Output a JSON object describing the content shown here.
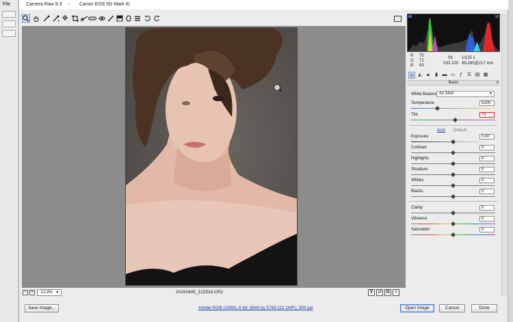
{
  "host": {
    "menu_file": "File"
  },
  "window": {
    "title": "Camera Raw 9.3",
    "camera": "Canon EOS 5D Mark III"
  },
  "toolbar": {
    "tools": [
      {
        "name": "zoom-tool-icon",
        "glyph": "🔍︎",
        "selected": true
      },
      {
        "name": "hand-tool-icon",
        "glyph": "✋︎"
      },
      {
        "name": "white-balance-tool-icon",
        "glyph": "⁄"
      },
      {
        "name": "color-sampler-tool-icon",
        "glyph": "⁄"
      },
      {
        "name": "targeted-adjustment-tool-icon",
        "glyph": "⊹"
      },
      {
        "name": "crop-tool-icon",
        "glyph": "⌗"
      },
      {
        "name": "straighten-tool-icon",
        "glyph": "≗"
      },
      {
        "name": "spot-removal-tool-icon",
        "glyph": "⚲"
      },
      {
        "name": "red-eye-tool-icon",
        "glyph": "◉"
      },
      {
        "name": "adjustment-brush-icon",
        "glyph": "⁄"
      },
      {
        "name": "graduated-filter-icon",
        "glyph": "▆"
      },
      {
        "name": "radial-filter-icon",
        "glyph": "◯"
      },
      {
        "name": "preferences-icon",
        "glyph": "≡"
      },
      {
        "name": "rotate-ccw-icon",
        "glyph": "↺"
      },
      {
        "name": "rotate-cw-icon",
        "glyph": "↻"
      }
    ]
  },
  "canvas": {
    "zoom": "12.9%",
    "filename": "20150405_122533.CR2"
  },
  "readout": {
    "r_label": "R:",
    "r_value": "75",
    "g_label": "G:",
    "g_value": "71",
    "b_label": "B:",
    "b_value": "63",
    "aperture": "f/8",
    "shutter": "1/125 s",
    "iso": "ISO 100",
    "lens": "98-280@217 mm"
  },
  "panel": {
    "section_title": "Basic",
    "white_balance_label": "White Balance:",
    "white_balance_value": "As Shot",
    "temperature_label": "Temperature",
    "temperature_value": "5200",
    "tint_label": "Tint",
    "tint_value": "+5",
    "auto_label": "Auto",
    "default_label": "Default",
    "exposure_label": "Exposure",
    "exposure_value": "0.00",
    "contrast_label": "Contrast",
    "contrast_value": "0",
    "highlights_label": "Highlights",
    "highlights_value": "0",
    "shadows_label": "Shadows",
    "shadows_value": "0",
    "whites_label": "Whites",
    "whites_value": "0",
    "blacks_label": "Blacks",
    "blacks_value": "0",
    "clarity_label": "Clarity",
    "clarity_value": "0",
    "vibrance_label": "Vibrance",
    "vibrance_value": "0",
    "saturation_label": "Saturation",
    "saturation_value": "0"
  },
  "footer": {
    "save_image": "Save Image...",
    "workflow": "Adobe RGB (1998); 8 bit; 3840 by 5760 (22.1MP); 300 ppi",
    "open_image": "Open Image",
    "cancel": "Cancel",
    "done": "Done"
  },
  "colors": {
    "accent": "#3a7bd5",
    "link": "#1a3fa8",
    "canvas_bg": "#8c8c8c"
  }
}
